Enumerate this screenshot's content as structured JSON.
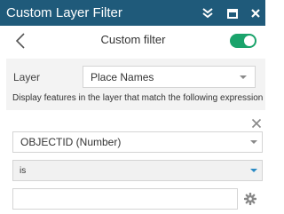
{
  "window": {
    "title": "Custom Layer Filter",
    "icons": [
      "chevrons-down-icon",
      "maximize-icon",
      "close-icon"
    ],
    "title_bar_color": "#1f5a7a"
  },
  "nav": {
    "back_icon": "chevron-left-icon",
    "title": "Custom filter",
    "toggle_on": true,
    "toggle_color": "#1aa36b"
  },
  "layer": {
    "label": "Layer",
    "selected": "Place Names"
  },
  "help_text": "Display features in the layer that match the following expression",
  "expression": {
    "remove_icon": "close-icon",
    "field": "OBJECTID (Number)",
    "operator": "is",
    "value": "",
    "options_icon": "gear-icon"
  }
}
